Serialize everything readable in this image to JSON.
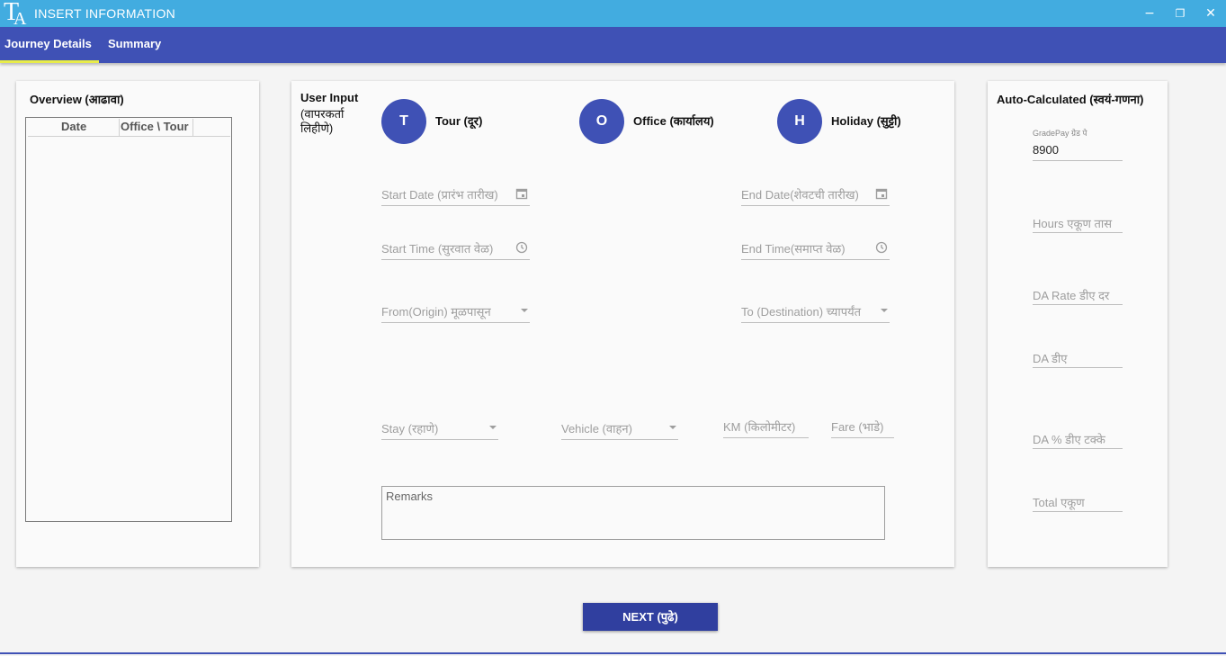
{
  "window": {
    "title": "INSERT INFORMATION",
    "logo_t": "T",
    "logo_a": "A",
    "minimize_glyph": "−",
    "restore_glyph": "❐",
    "close_glyph": "✕"
  },
  "tabs": [
    {
      "label": "Journey Details",
      "active": true
    },
    {
      "label": "Summary",
      "active": false
    }
  ],
  "overview": {
    "title": "Overview (आढावा)",
    "columns": [
      "Date",
      "Office \\ Tour"
    ]
  },
  "user_input": {
    "title_line1": "User Input",
    "title_line2": "(वापरकर्ता",
    "title_line3": "लिहीणे)",
    "categories": [
      {
        "letter": "T",
        "label": "Tour (दूर)"
      },
      {
        "letter": "O",
        "label": "Office (कार्यालय)"
      },
      {
        "letter": "H",
        "label": "Holiday (सुट्टी)"
      }
    ],
    "start_date_placeholder": "Start Date (प्रारंभ तारीख)",
    "end_date_placeholder": "End Date(शेवटची तारीख)",
    "start_time_placeholder": "Start Time (सुरवात वेळ)",
    "end_time_placeholder": "End Time(समाप्त वेळ)",
    "from_placeholder": "From(Origin) मूळपासून",
    "to_placeholder": "To (Destination) च्यापर्यंत",
    "stay_placeholder": "Stay (रहाणे)",
    "vehicle_placeholder": "Vehicle (वाहन)",
    "km_placeholder": "KM (किलोमीटर)",
    "fare_placeholder": "Fare (भाडे)",
    "remarks_placeholder": "Remarks"
  },
  "auto_calculated": {
    "title": "Auto-Calculated (स्वयं-गणना)",
    "gradepay_label": "GradePay ग्रेड पे",
    "gradepay_value": "8900",
    "hours_placeholder": "Hours एकूण तास",
    "da_rate_placeholder": "DA Rate डीए दर",
    "da_placeholder": "DA डीए",
    "da_percent_placeholder": "DA % डीए टक्के",
    "total_placeholder": "Total एकूण"
  },
  "next_button": "NEXT (पुढे)",
  "colors": {
    "titlebar": "#42ace0",
    "tabbar": "#3f51b5",
    "accent": "#3f51b5",
    "tab_underline": "#e8ec4a",
    "button": "#303f9f"
  }
}
